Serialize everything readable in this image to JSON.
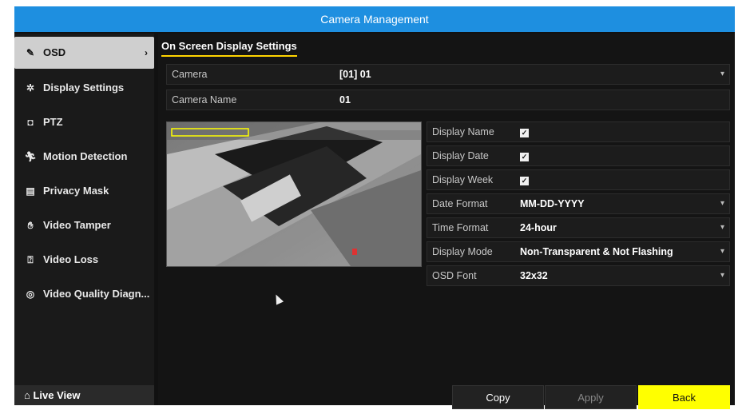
{
  "window": {
    "title": "Camera Management"
  },
  "sidebar": {
    "items": [
      {
        "icon": "edit-icon",
        "label": "OSD",
        "active": true
      },
      {
        "icon": "display-settings-icon",
        "label": "Display Settings"
      },
      {
        "icon": "ptz-icon",
        "label": "PTZ"
      },
      {
        "icon": "motion-icon",
        "label": "Motion Detection"
      },
      {
        "icon": "privacy-mask-icon",
        "label": "Privacy Mask"
      },
      {
        "icon": "tamper-icon",
        "label": "Video Tamper"
      },
      {
        "icon": "video-loss-icon",
        "label": "Video Loss"
      },
      {
        "icon": "diagnosis-icon",
        "label": "Video Quality Diagn..."
      }
    ],
    "live_view": "Live View"
  },
  "main": {
    "tab": "On Screen Display Settings",
    "camera": {
      "label": "Camera",
      "value": "[01] 01"
    },
    "camera_name": {
      "label": "Camera Name",
      "value": "01"
    },
    "settings": [
      {
        "label": "Display Name",
        "type": "checkbox",
        "checked": true
      },
      {
        "label": "Display Date",
        "type": "checkbox",
        "checked": true
      },
      {
        "label": "Display Week",
        "type": "checkbox",
        "checked": true
      },
      {
        "label": "Date Format",
        "type": "select",
        "value": "MM-DD-YYYY"
      },
      {
        "label": "Time Format",
        "type": "select",
        "value": "24-hour"
      },
      {
        "label": "Display Mode",
        "type": "select",
        "value": "Non-Transparent & Not Flashing"
      },
      {
        "label": "OSD Font",
        "type": "select",
        "value": "32x32"
      }
    ]
  },
  "buttons": {
    "copy": "Copy",
    "apply": "Apply",
    "back": "Back"
  },
  "colors": {
    "titlebar": "#1e8fe0",
    "accent": "#ffff00",
    "tab_underline": "#ffd400"
  }
}
